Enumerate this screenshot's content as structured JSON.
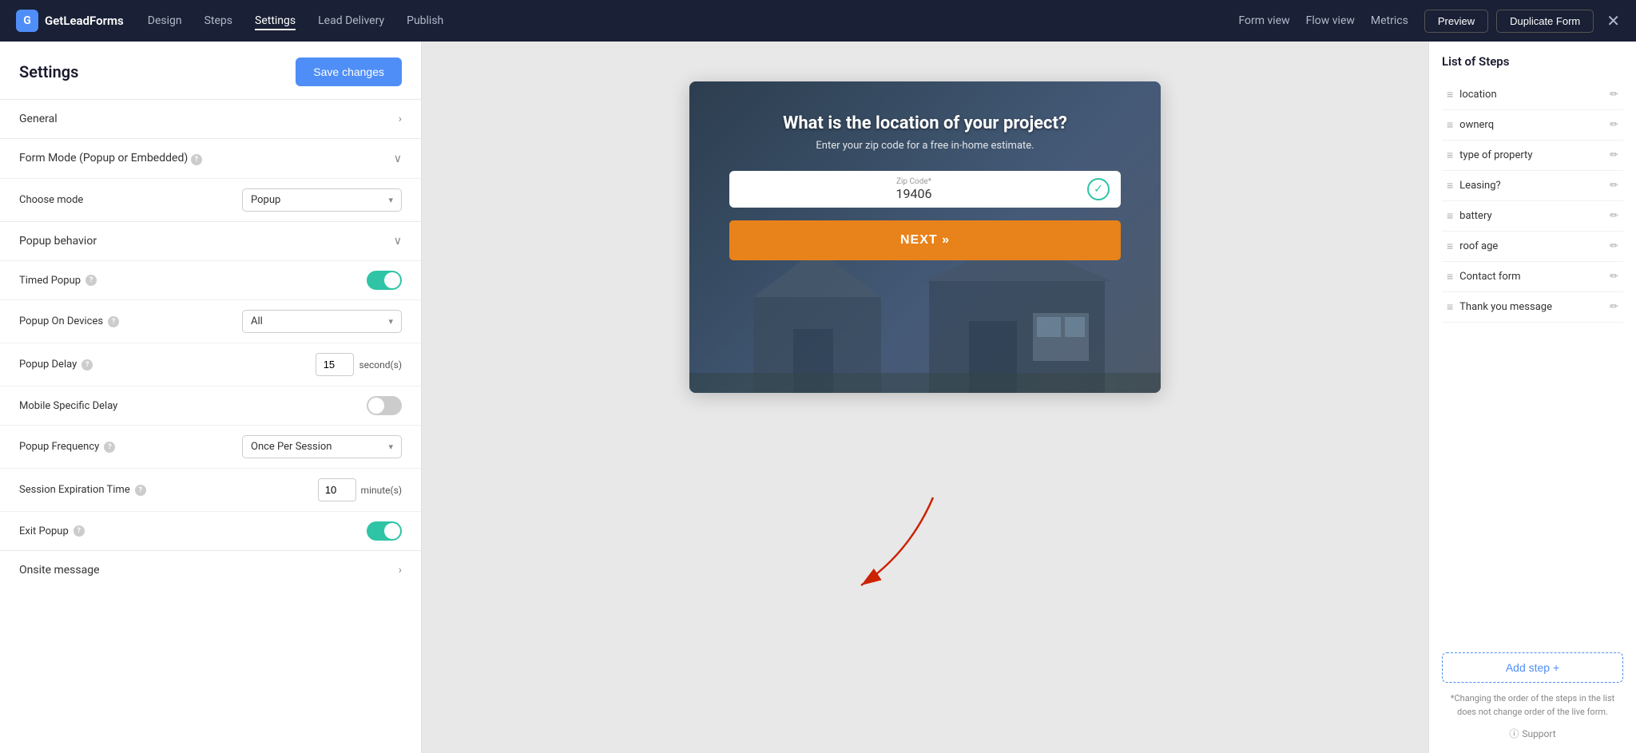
{
  "app": {
    "logo_text": "GetLeadForms",
    "logo_icon": "G"
  },
  "topnav": {
    "links": [
      {
        "label": "Design",
        "active": false
      },
      {
        "label": "Steps",
        "active": false
      },
      {
        "label": "Settings",
        "active": true
      },
      {
        "label": "Lead Delivery",
        "active": false
      },
      {
        "label": "Publish",
        "active": false
      }
    ],
    "view_options": [
      "Form view",
      "Flow view",
      "Metrics"
    ],
    "preview_label": "Preview",
    "duplicate_label": "Duplicate Form",
    "close_icon": "✕"
  },
  "sidebar": {
    "title": "Settings",
    "save_button": "Save changes",
    "sections": [
      {
        "label": "General",
        "type": "expand"
      },
      {
        "label": "Form Mode (Popup or Embedded)",
        "type": "collapse",
        "has_help": true
      }
    ],
    "choose_mode_label": "Choose mode",
    "choose_mode_value": "Popup",
    "popup_behavior_label": "Popup behavior",
    "settings": [
      {
        "label": "Timed Popup",
        "type": "toggle",
        "value": true,
        "has_help": true
      },
      {
        "label": "Popup On Devices",
        "type": "select",
        "value": "All",
        "has_help": true
      },
      {
        "label": "Popup Delay",
        "type": "number",
        "value": "15",
        "unit": "second(s)",
        "has_help": true
      },
      {
        "label": "Mobile Specific Delay",
        "type": "toggle",
        "value": false
      },
      {
        "label": "Popup Frequency",
        "type": "select",
        "value": "Once Per Session",
        "has_help": true
      },
      {
        "label": "Session Expiration Time",
        "type": "number",
        "value": "10",
        "unit": "minute(s)",
        "has_help": true
      },
      {
        "label": "Exit Popup",
        "type": "toggle",
        "value": true,
        "has_help": true
      }
    ],
    "onsite_label": "Onsite message"
  },
  "preview": {
    "question": "What is the location of your project?",
    "subtitle": "Enter your zip code for a free in-home estimate.",
    "input_label": "Zip Code*",
    "input_value": "19406",
    "next_button": "NEXT »"
  },
  "right_panel": {
    "title": "List of Steps",
    "steps": [
      {
        "name": "location"
      },
      {
        "name": "ownerq"
      },
      {
        "name": "type of property"
      },
      {
        "name": "Leasing?"
      },
      {
        "name": "battery"
      },
      {
        "name": "roof age"
      },
      {
        "name": "Contact form"
      },
      {
        "name": "Thank you message"
      }
    ],
    "add_step_label": "Add step +",
    "note": "*Changing the order of the steps in the list does not change order of the live form.",
    "support_label": "Support"
  }
}
